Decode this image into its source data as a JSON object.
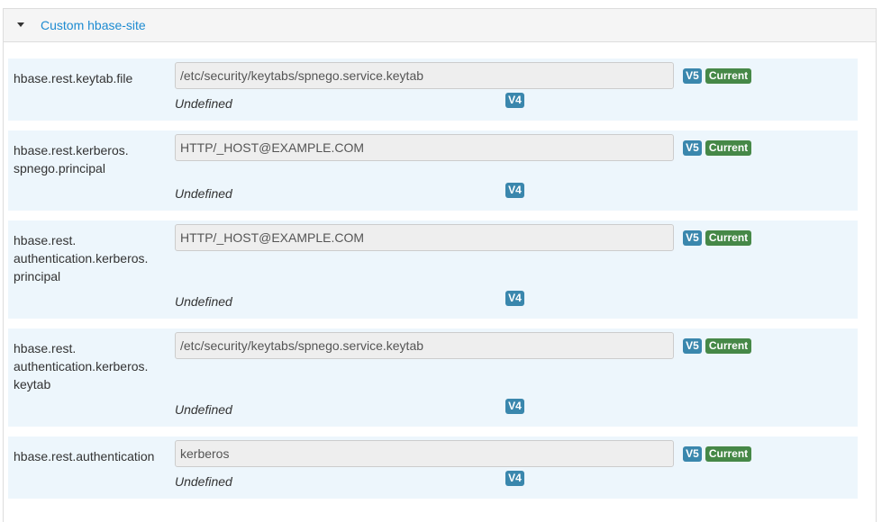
{
  "section": {
    "title": "Custom hbase-site"
  },
  "rows": [
    {
      "label": "hbase.rest.keytab.file",
      "value": "/etc/security/keytabs/spnego.service.keytab",
      "v5": "V5",
      "current": "Current",
      "v4": "V4",
      "v4_value": "Undefined"
    },
    {
      "label": "hbase.rest.kerberos.\nspnego.principal",
      "value": "HTTP/_HOST@EXAMPLE.COM",
      "v5": "V5",
      "current": "Current",
      "v4": "V4",
      "v4_value": "Undefined"
    },
    {
      "label": "hbase.rest.\nauthentication.kerberos.\nprincipal",
      "value": "HTTP/_HOST@EXAMPLE.COM",
      "v5": "V5",
      "current": "Current",
      "v4": "V4",
      "v4_value": "Undefined"
    },
    {
      "label": "hbase.rest.\nauthentication.kerberos.\nkeytab",
      "value": "/etc/security/keytabs/spnego.service.keytab",
      "v5": "V5",
      "current": "Current",
      "v4": "V4",
      "v4_value": "Undefined"
    },
    {
      "label": "hbase.rest.authentication",
      "value": "kerberos",
      "v5": "V5",
      "current": "Current",
      "v4": "V4",
      "v4_value": "Undefined"
    }
  ]
}
